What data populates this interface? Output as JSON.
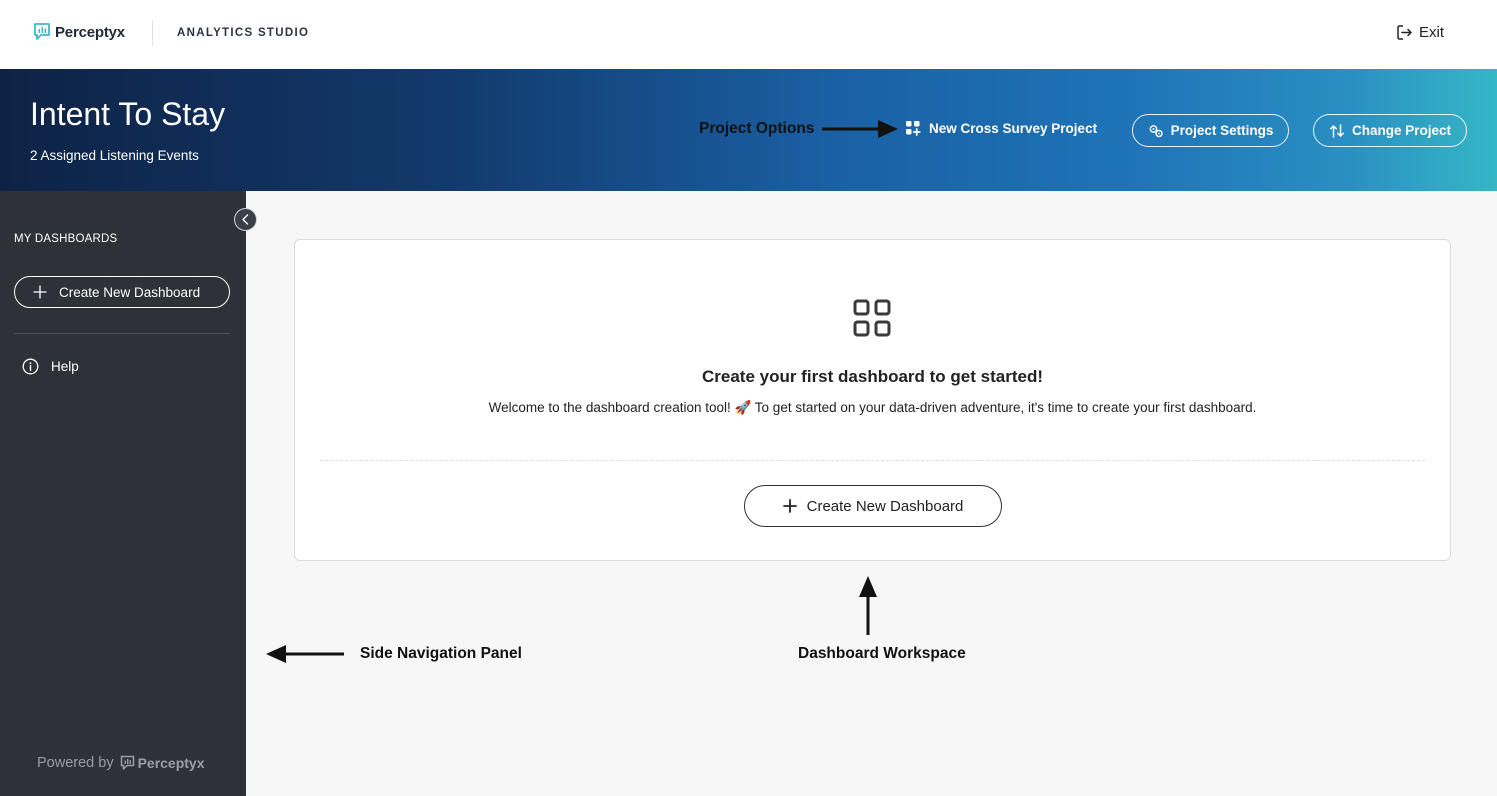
{
  "topbar": {
    "brand_name": "Perceptyx",
    "studio_label": "ANALYTICS STUDIO",
    "exit_label": "Exit"
  },
  "banner": {
    "title": "Intent To Stay",
    "subtitle": "2 Assigned Listening Events",
    "new_cross_survey_label": "New Cross Survey Project",
    "project_settings_label": "Project Settings",
    "change_project_label": "Change Project"
  },
  "sidebar": {
    "heading": "MY DASHBOARDS",
    "create_label": "Create New Dashboard",
    "help_label": "Help",
    "powered_by": "Powered by",
    "powered_brand": "Perceptyx"
  },
  "main": {
    "empty_title": "Create your first dashboard to get started!",
    "empty_text": "Welcome to the dashboard creation tool! 🚀 To get started on your data-driven adventure, it's time to create your first dashboard.",
    "create_label": "Create New Dashboard"
  },
  "annotations": {
    "project_options": "Project Options",
    "side_nav": "Side Navigation Panel",
    "workspace": "Dashboard Workspace"
  },
  "icons": {
    "brand_logo": "perceptyx-logo-icon",
    "exit": "exit-icon",
    "grid_plus": "grid-plus-icon",
    "settings": "settings-icon",
    "change": "swap-icon",
    "collapse": "chevron-left-icon",
    "plus": "plus-icon",
    "help": "info-icon",
    "dashboard": "dashboard-grid-icon"
  },
  "colors": {
    "brand_teal": "#3fb8c9",
    "sidebar_bg": "#2e3138",
    "banner_start": "#0e2245",
    "banner_end": "#35b7c6"
  }
}
